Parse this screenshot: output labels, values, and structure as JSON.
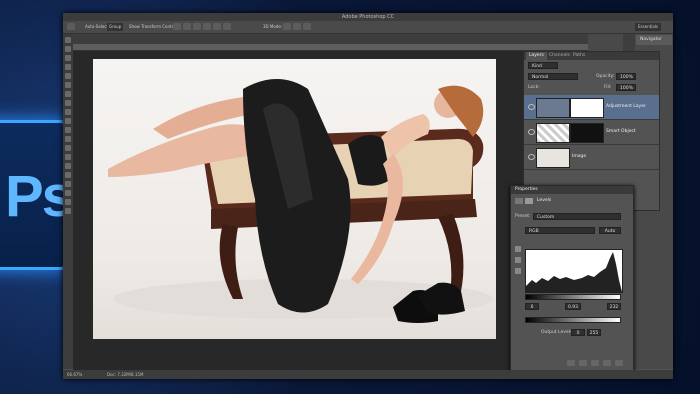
{
  "app": {
    "title": "Adobe Photoshop CC",
    "workspace": "Essentials",
    "doc_zoom": "66.7%"
  },
  "options_bar": {
    "auto_select": "Auto-Select:",
    "auto_select_target": "Group",
    "show_transform": "Show Transform Controls",
    "mode_3d": "3D Mode:"
  },
  "status": {
    "zoom": "66.67%",
    "doc": "Doc: 7.32M/8.15M"
  },
  "navigator_tab": "Navigator",
  "layers_panel": {
    "tabs": [
      "Layers",
      "Channels",
      "Paths"
    ],
    "filter_label": "Kind",
    "blend_mode": "Normal",
    "opacity_label": "Opacity:",
    "opacity_value": "100%",
    "lock_label": "Lock:",
    "fill_label": "Fill:",
    "fill_value": "100%",
    "layers": [
      {
        "name": "Adjustment Layer"
      },
      {
        "name": "Smart Object"
      },
      {
        "name": "Image"
      }
    ]
  },
  "properties_panel": {
    "tab": "Properties",
    "title": "Levels",
    "preset_label": "Preset:",
    "preset_value": "Custom",
    "channel": "RGB",
    "auto_button": "Auto",
    "input_shadow": "6",
    "input_mid": "0.93",
    "input_highlight": "232",
    "output_label": "Output Levels:",
    "output_low": "0",
    "output_high": "255"
  },
  "colors": {
    "accent": "#5a6f8e",
    "ps_blue": "#3aa8ff"
  },
  "icons": [
    "eye-icon",
    "levels-icon",
    "eyedropper-icon",
    "trash-icon",
    "mask-icon",
    "ps-logo"
  ]
}
